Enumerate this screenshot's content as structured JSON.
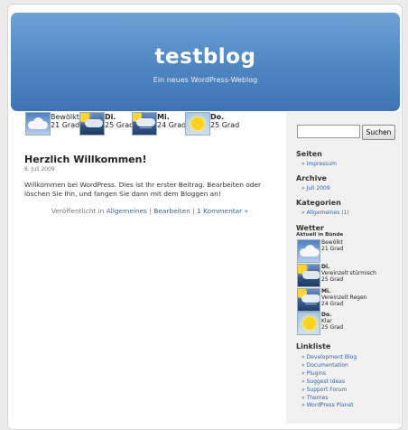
{
  "blog": {
    "title": "testblog",
    "description": "Ein neues WordPress-Weblog"
  },
  "weather_bar": [
    {
      "day": "",
      "condition": "Bewölkt",
      "temp": "21 Grad",
      "icon": "cloudy-icon"
    },
    {
      "day": "Di.",
      "condition": "",
      "temp": "25 Grad",
      "icon": "stormy-icon"
    },
    {
      "day": "Mi.",
      "condition": "",
      "temp": "24 Grad",
      "icon": "rain-icon"
    },
    {
      "day": "Do.",
      "condition": "",
      "temp": "25 Grad",
      "icon": "sunny-icon"
    }
  ],
  "post": {
    "title": "Herzlich Willkommen!",
    "date": "8. Juli 2009",
    "body": "Willkommen bei WordPress. Dies ist Ihr erster Beitrag. Bearbeiten oder löschen Sie Ihn, und fangen Sie dann mit dem Bloggen an!",
    "meta_prefix": "Veröffentlicht in",
    "category": "Allgemeines",
    "edit": "Bearbeiten",
    "comments": "1 Kommentar »",
    "separator": "|"
  },
  "sidebar": {
    "search_button": "Suchen",
    "search_value": "",
    "seiten": {
      "heading": "Seiten",
      "items": [
        "» Impressum"
      ]
    },
    "archive": {
      "heading": "Archive",
      "items": [
        "» Juli 2009"
      ]
    },
    "kategorien": {
      "heading": "Kategorien",
      "item": "» Allgemeines",
      "count": "(1)"
    },
    "wetter": {
      "heading": "Wetter",
      "subheading": "Aktuell in Bünde",
      "items": [
        {
          "day": "",
          "condition": "Bewölkt",
          "temp": "21 Grad",
          "icon": "cloudy-icon"
        },
        {
          "day": "Di.",
          "condition": "Vereinzelt stürmisch",
          "temp": "25 Grad",
          "icon": "stormy-icon"
        },
        {
          "day": "Mi.",
          "condition": "Vereinzelt Regen",
          "temp": "24 Grad",
          "icon": "rain-icon"
        },
        {
          "day": "Do.",
          "condition": "Klar",
          "temp": "25 Grad",
          "icon": "sunny-icon"
        }
      ]
    },
    "linkliste": {
      "heading": "Linkliste",
      "items": [
        "» Development Blog",
        "» Documentation",
        "» Plugins",
        "» Suggest Ideas",
        "» Support Forum",
        "» Themes",
        "» WordPress Planet"
      ]
    }
  }
}
